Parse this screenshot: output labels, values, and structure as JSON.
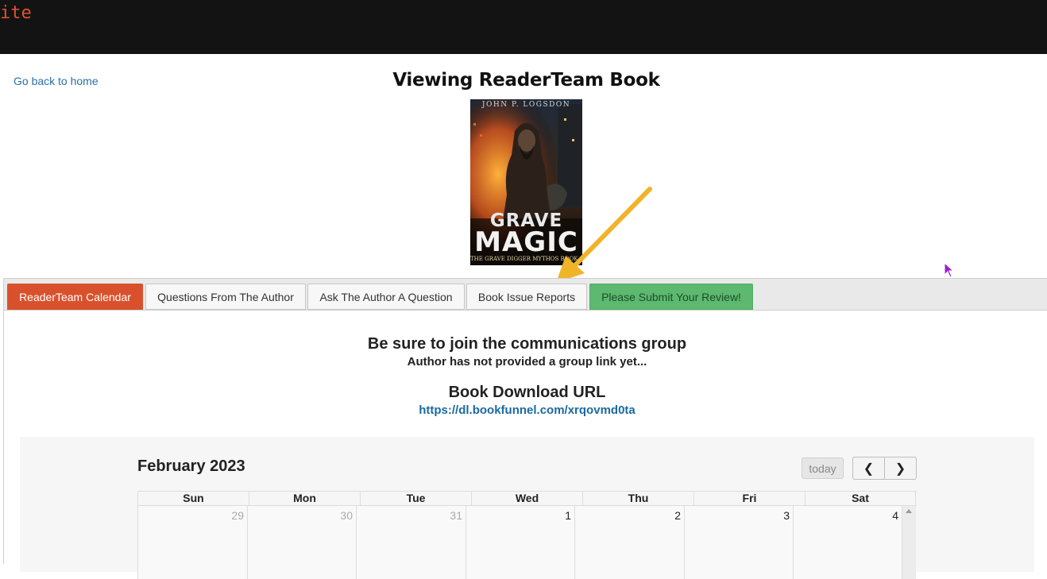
{
  "header": {
    "brand_text": "ite"
  },
  "nav": {
    "back_link": "Go back to home"
  },
  "page": {
    "title": "Viewing ReaderTeam Book"
  },
  "book_cover": {
    "author": "JOHN P. LOGSDON",
    "title_line1": "GRAVE",
    "title_line2": "MAGIC",
    "series": "THE GRAVE DIGGER MYTHOS BOOK ONE"
  },
  "tabs": [
    {
      "label": "ReaderTeam Calendar",
      "active": true
    },
    {
      "label": "Questions From The Author",
      "active": false
    },
    {
      "label": "Ask The Author A Question",
      "active": false
    },
    {
      "label": "Book Issue Reports",
      "active": false
    },
    {
      "label": "Please Submit Your Review!",
      "active": false
    }
  ],
  "panel": {
    "comm_title": "Be sure to join the communications group",
    "comm_subtitle": "Author has not provided a group link yet...",
    "download_title": "Book Download URL",
    "download_url": "https://dl.bookfunnel.com/xrqovmd0ta"
  },
  "calendar": {
    "month_title": "February 2023",
    "today_label": "today",
    "prev_icon": "chevron-left-icon",
    "next_icon": "chevron-right-icon",
    "weekdays": [
      "Sun",
      "Mon",
      "Tue",
      "Wed",
      "Thu",
      "Fri",
      "Sat"
    ],
    "first_week": [
      {
        "day": "29",
        "other_month": true
      },
      {
        "day": "30",
        "other_month": true
      },
      {
        "day": "31",
        "other_month": true
      },
      {
        "day": "1",
        "other_month": false
      },
      {
        "day": "2",
        "other_month": false
      },
      {
        "day": "3",
        "other_month": false
      },
      {
        "day": "4",
        "other_month": false
      }
    ]
  },
  "colors": {
    "accent_orange": "#d9512c",
    "review_green": "#5cb96f",
    "link_blue": "#1a6aa0",
    "annotation_arrow": "#f0b429"
  }
}
